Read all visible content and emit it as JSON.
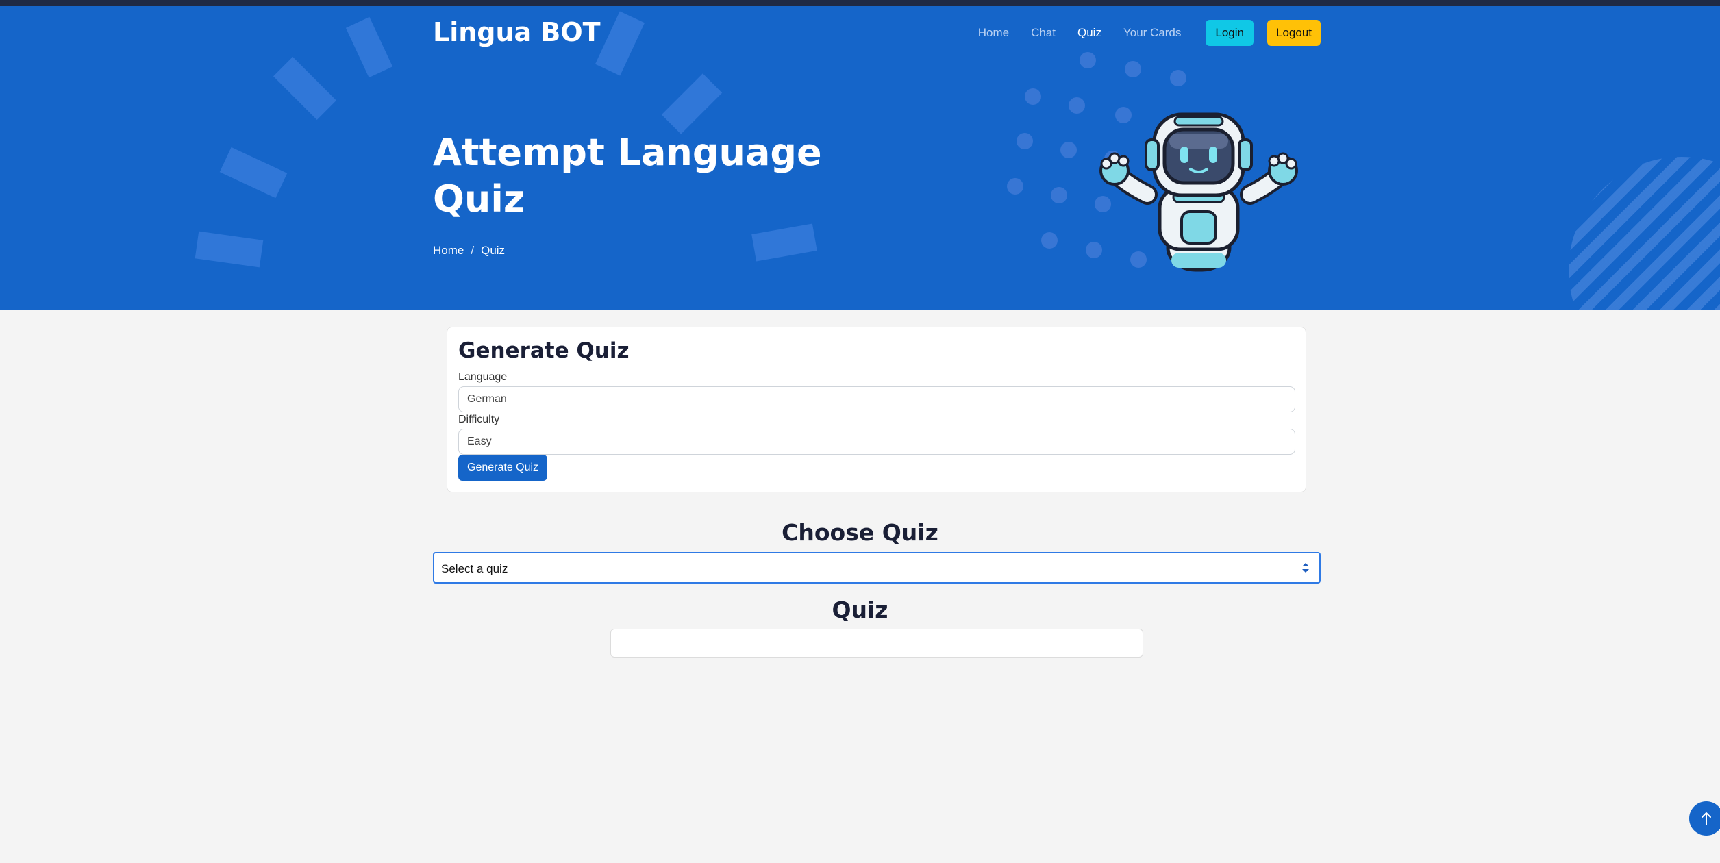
{
  "brand": "Lingua BOT",
  "nav": {
    "items": [
      {
        "label": "Home"
      },
      {
        "label": "Chat"
      },
      {
        "label": "Quiz",
        "active": true
      },
      {
        "label": "Your Cards"
      }
    ],
    "login_label": "Login",
    "logout_label": "Logout"
  },
  "hero": {
    "title": "Attempt Language Quiz",
    "breadcrumb": [
      "Home",
      "Quiz"
    ],
    "breadcrumb_separator": "/"
  },
  "generate": {
    "title": "Generate Quiz",
    "language_label": "Language",
    "language_value": "German",
    "difficulty_label": "Difficulty",
    "difficulty_value": "Easy",
    "button_label": "Generate Quiz"
  },
  "choose": {
    "title": "Choose Quiz",
    "select_value": "Select a quiz"
  },
  "quiz": {
    "title": "Quiz"
  },
  "icons": {
    "robot": "robot-mascot-icon",
    "back_to_top": "arrow-up-icon"
  },
  "colors": {
    "primary": "#1565c9",
    "login": "#10c8e6",
    "logout": "#ffc107",
    "background": "#f4f4f4",
    "heading": "#1a1f36"
  }
}
